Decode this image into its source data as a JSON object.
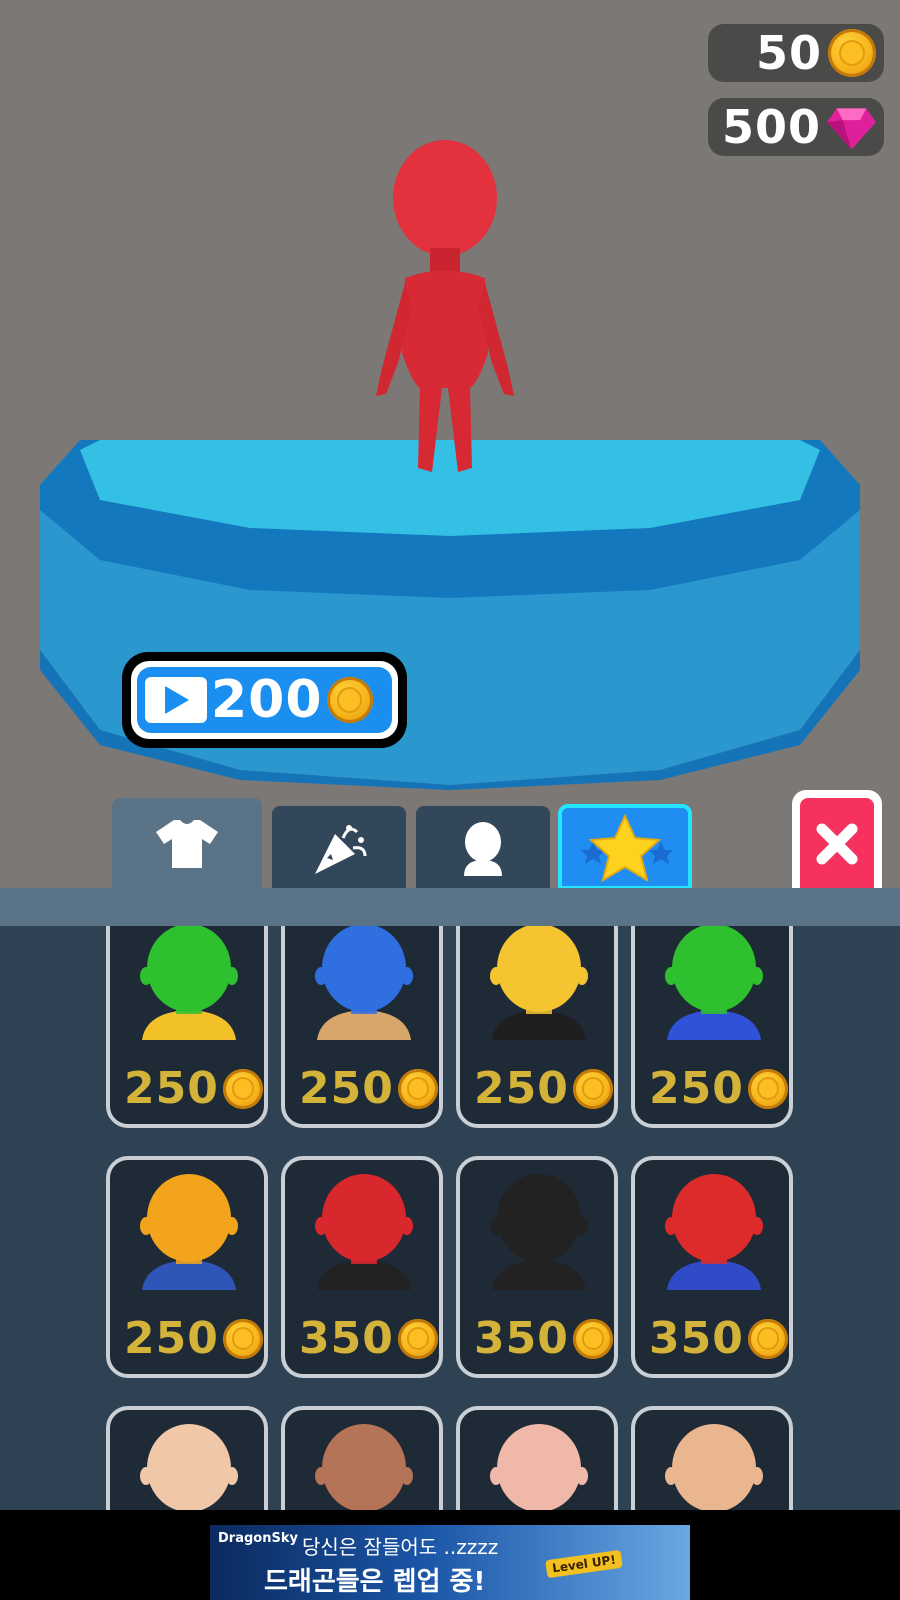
{
  "hud": {
    "coins": "50",
    "gems": "500"
  },
  "reward_button": {
    "amount": "200"
  },
  "tabs": [
    {
      "name": "outfits",
      "icon": "shirt-icon",
      "active": true
    },
    {
      "name": "celebrations",
      "icon": "party-popper-icon",
      "active": false
    },
    {
      "name": "heads",
      "icon": "head-icon",
      "active": false
    },
    {
      "name": "special",
      "icon": "star-icon",
      "active": false
    }
  ],
  "shop_items": [
    {
      "price": "250",
      "color": "#2fc02f",
      "shirt": "#f2c12a"
    },
    {
      "price": "250",
      "color": "#2f6fe0",
      "shirt": "#d8a56a"
    },
    {
      "price": "250",
      "color": "#f4c531",
      "shirt": "#1f1f1f"
    },
    {
      "price": "250",
      "color": "#2fc02f",
      "shirt": "#2f52d8"
    },
    {
      "price": "250",
      "color": "#f2a51c",
      "shirt": "#2f55b8"
    },
    {
      "price": "350",
      "color": "#d9272e",
      "shirt": "#222222"
    },
    {
      "price": "350",
      "color": "#222222",
      "shirt": "#222222"
    },
    {
      "price": "350",
      "color": "#dd2b2b",
      "shirt": "#2f4bc8"
    },
    {
      "price": "",
      "color": "#f0c8a8",
      "shirt": "#c92b2b"
    },
    {
      "price": "",
      "color": "#b57358",
      "shirt": "#2a2a2a"
    },
    {
      "price": "",
      "color": "#f0b8a8",
      "shirt": "#d03030"
    },
    {
      "price": "",
      "color": "#e9b690",
      "shirt": "#c8a080"
    }
  ],
  "banner": {
    "brand": "DragonSky",
    "line1": "당신은 잠들어도 ..zzzz",
    "line2": "드래곤들은 렙업 중!",
    "badge": "Level UP!"
  },
  "colors": {
    "background": "#7b7876",
    "pedestal": "#2b9ed6",
    "character": "#e0303a",
    "panel": "#2f4254",
    "price_text": "#d4b33a",
    "close_button": "#f5325e"
  }
}
